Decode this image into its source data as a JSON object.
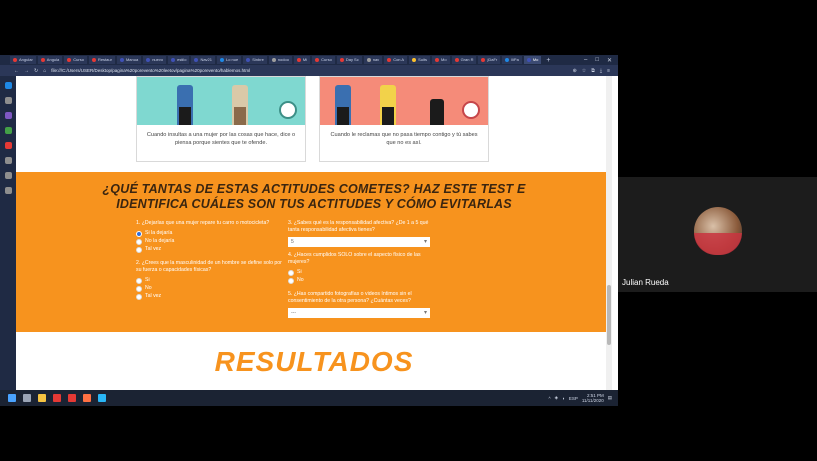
{
  "browser": {
    "tabs": [
      {
        "label": "Angular",
        "color": "#e53935"
      },
      {
        "label": "Angula",
        "color": "#e53935"
      },
      {
        "label": "Curso",
        "color": "#e53935"
      },
      {
        "label": "Restaur",
        "color": "#e53935"
      },
      {
        "label": "Manua",
        "color": "#3f51b5"
      },
      {
        "label": "nuevo",
        "color": "#3f51b5"
      },
      {
        "label": "estilo",
        "color": "#3f51b5"
      },
      {
        "label": "Nav21",
        "color": "#3f51b5"
      },
      {
        "label": "Lo nue",
        "color": "#1e88e5"
      },
      {
        "label": "Sinbre",
        "color": "#3f51b5"
      },
      {
        "label": "nodoo",
        "color": "#9e9e9e"
      },
      {
        "label": "Mi",
        "color": "#e53935"
      },
      {
        "label": "Curso",
        "color": "#e53935"
      },
      {
        "label": "Day Sc",
        "color": "#e53935"
      },
      {
        "label": "nav",
        "color": "#9e9e9e"
      },
      {
        "label": "Con A",
        "color": "#e53935"
      },
      {
        "label": "Suits",
        "color": "#fbc02d"
      },
      {
        "label": "Mo",
        "color": "#e53935"
      },
      {
        "label": "Gran R",
        "color": "#e53935"
      },
      {
        "label": "jDaFr",
        "color": "#e53935"
      },
      {
        "label": "lliPa",
        "color": "#1e88e5"
      },
      {
        "label": "Mo",
        "color": "#3f51b5",
        "active": true
      }
    ],
    "url": "file:///C:/Users/USER/Desktop/pagina%20porevento%20leetov/pagina%20porevento/hablemos.html"
  },
  "cards": [
    {
      "caption": "Cuando insultas a una mujer por las cosas que hace, dice o piensa porque sientes que te ofende."
    },
    {
      "caption": "Cuando le reclamas que no pasa tiempo contigo y tú sabes que no es así."
    }
  ],
  "quiz": {
    "title_line1": "¿QUÉ TANTAS DE ESTAS ACTITUDES COMETES? HAZ ESTE TEST E",
    "title_line2": "IDENTIFICA CUÁLES SON TUS ACTITUDES Y CÓMO EVITARLAS",
    "q1": {
      "question": "1. ¿Dejarías que una mujer repare tu carro o motocicleta?",
      "options": [
        "Si la dejaría",
        "No la dejaría",
        "Tal vez"
      ],
      "selected": 0
    },
    "q2": {
      "question": "2. ¿Crees que la masculinidad de un hombre se define solo por su fuerza o capacidades físicas?",
      "options": [
        "Si",
        "No",
        "Tal vez"
      ]
    },
    "q3": {
      "question": "3. ¿Sabes qué es la responsabilidad afectiva? ¿De 1 a 5 qué tanta responsabilidad afectiva tienes?",
      "value": "5"
    },
    "q4": {
      "question": "4. ¿Haces cumplidos SOLO sobre el aspecto físico de las mujeres?",
      "options": [
        "Si",
        "No"
      ]
    },
    "q5": {
      "question": "5. ¿Has compartido fotografías o videos íntimos sin el consentimiento de la otra persona? ¿Cuántas veces?",
      "value": "---"
    }
  },
  "results_heading": "RESULTADOS",
  "taskbar": {
    "time": "2:51 PM",
    "date": "11/11/2020",
    "lang": "ESP"
  },
  "participant": {
    "name": "Julian Rueda"
  }
}
